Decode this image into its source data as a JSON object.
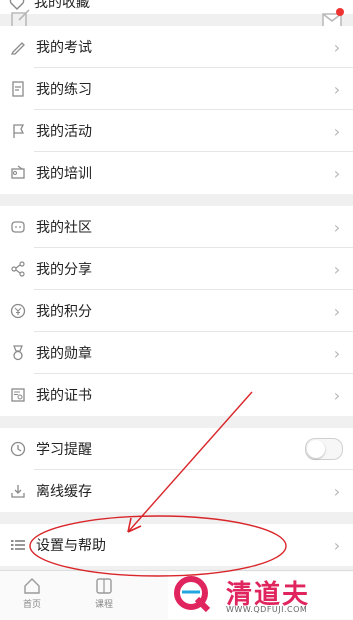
{
  "top_partial": {
    "label": "我的收藏",
    "icon": "heart-icon"
  },
  "groups": [
    {
      "items": [
        {
          "label": "我的考试",
          "icon": "pencil-icon"
        },
        {
          "label": "我的练习",
          "icon": "document-icon"
        },
        {
          "label": "我的活动",
          "icon": "flag-icon"
        },
        {
          "label": "我的培训",
          "icon": "presenter-icon"
        }
      ]
    },
    {
      "items": [
        {
          "label": "我的社区",
          "icon": "chat-icon"
        },
        {
          "label": "我的分享",
          "icon": "share-icon"
        },
        {
          "label": "我的积分",
          "icon": "coin-icon"
        },
        {
          "label": "我的勋章",
          "icon": "medal-icon"
        },
        {
          "label": "我的证书",
          "icon": "certificate-icon"
        }
      ]
    },
    {
      "items": [
        {
          "label": "学习提醒",
          "icon": "clock-icon",
          "control": "toggle",
          "toggle_on": false
        },
        {
          "label": "离线缓存",
          "icon": "download-icon"
        }
      ]
    },
    {
      "items": [
        {
          "label": "设置与帮助",
          "icon": "list-icon"
        }
      ]
    }
  ],
  "tabbar": [
    {
      "label": "首页",
      "icon": "home-icon"
    },
    {
      "label": "课程",
      "icon": "book-icon"
    }
  ],
  "watermark": {
    "title": "清道夫",
    "url": "WWW.QDFUJI.COM"
  },
  "colors": {
    "annotation": "#d9262a",
    "watermark": "#e0245e",
    "mail_badge": "#ee3333"
  }
}
